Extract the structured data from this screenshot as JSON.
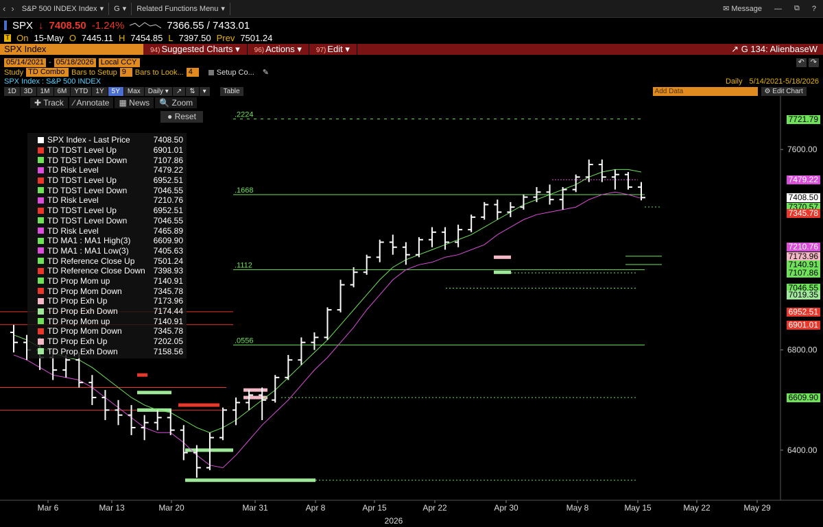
{
  "topbar": {
    "crumbs": [
      "S&P 500 INDEX Index",
      "G",
      "Related Functions Menu"
    ],
    "message": "Message",
    "icons": [
      "back-icon",
      "forward-icon",
      "chevron-down-icon",
      "envelope-icon",
      "minus-icon",
      "restore-icon",
      "help-icon"
    ]
  },
  "quote": {
    "ticker": "SPX",
    "last": "7408.50",
    "change_pct": "-1.24%",
    "range": "7366.55 / 7433.01",
    "on_label": "On",
    "date": "15-May",
    "open_label": "O",
    "open": "7445.11",
    "high_label": "H",
    "high": "7454.85",
    "low_label": "L",
    "low": "7397.50",
    "prev_label": "Prev",
    "prev": "7501.24"
  },
  "menu": {
    "ticker_field": "SPX Index",
    "items": [
      {
        "num": "94)",
        "label": "Suggested Charts"
      },
      {
        "num": "96)",
        "label": "Actions"
      },
      {
        "num": "97)",
        "label": "Edit"
      }
    ],
    "group": "G 134: AlienbaseW"
  },
  "dates": {
    "start": "05/14/2021",
    "end": "05/18/2026",
    "ccy": "Local CCY"
  },
  "study": {
    "label": "Study",
    "name": "TD Combo",
    "bars_setup_label": "Bars to Setup",
    "bars_setup": "9",
    "bars_look_label": "Bars to Look...",
    "bars_look": "4",
    "setup_co": "Setup Co..."
  },
  "subtitle": {
    "left": "SPX Index : S&P 500 INDEX",
    "period": "Daily",
    "range": "5/14/2021-5/18/2026"
  },
  "rangebar": {
    "buttons": [
      "1D",
      "3D",
      "1M",
      "6M",
      "YTD",
      "1Y",
      "5Y",
      "Max"
    ],
    "selected": "5Y",
    "freq": "Daily",
    "table": "Table",
    "add_data": "Add Data",
    "edit_chart": "Edit Chart"
  },
  "tools": {
    "track": "Track",
    "annotate": "Annotate",
    "news": "News",
    "zoom": "Zoom",
    "reset": "Reset"
  },
  "legend": [
    {
      "name": "SPX Index - Last Price",
      "value": "7408.50",
      "color": "#ffffff"
    },
    {
      "name": "TD TDST Level Up",
      "value": "6901.01",
      "color": "#e8372b"
    },
    {
      "name": "TD TDST Level Down",
      "value": "7107.86",
      "color": "#6fe25a"
    },
    {
      "name": "TD Risk Level",
      "value": "7479.22",
      "color": "#d94fd9"
    },
    {
      "name": "TD TDST Level Up",
      "value": "6952.51",
      "color": "#e8372b"
    },
    {
      "name": "TD TDST Level Down",
      "value": "7046.55",
      "color": "#6fe25a"
    },
    {
      "name": "TD Risk Level",
      "value": "7210.76",
      "color": "#d94fd9"
    },
    {
      "name": "TD TDST Level Up",
      "value": "6952.51",
      "color": "#e8372b"
    },
    {
      "name": "TD TDST Level Down",
      "value": "7046.55",
      "color": "#6fe25a"
    },
    {
      "name": "TD Risk Level",
      "value": "7465.89",
      "color": "#d94fd9"
    },
    {
      "name": "TD MA1 : MA1 High(3)",
      "value": "6609.90",
      "color": "#6fe25a"
    },
    {
      "name": "TD MA1 : MA1 Low(3)",
      "value": "7405.63",
      "color": "#d94fd9"
    },
    {
      "name": "TD Reference Close Up",
      "value": "7501.24",
      "color": "#6fe25a"
    },
    {
      "name": "TD Reference Close Down",
      "value": "7398.93",
      "color": "#e8372b"
    },
    {
      "name": "TD Prop Mom up",
      "value": "7140.91",
      "color": "#6fe25a"
    },
    {
      "name": "TD Prop Mom Down",
      "value": "7345.78",
      "color": "#e8372b"
    },
    {
      "name": "TD Prop Exh Up",
      "value": "7173.96",
      "color": "#f2b8c6"
    },
    {
      "name": "TD Prop Exh Down",
      "value": "7174.44",
      "color": "#9fe89a"
    },
    {
      "name": "TD Prop Mom up",
      "value": "7140.91",
      "color": "#6fe25a"
    },
    {
      "name": "TD Prop Mom Down",
      "value": "7345.78",
      "color": "#e8372b"
    },
    {
      "name": "TD Prop Exh Up",
      "value": "7202.05",
      "color": "#f2b8c6"
    },
    {
      "name": "TD Prop Exh Down",
      "value": "7158.56",
      "color": "#9fe89a"
    }
  ],
  "price_labels": [
    {
      "text": "7721.79",
      "value": 7721.79,
      "color": "#6fe25a"
    },
    {
      "text": "7479.22",
      "value": 7479.22,
      "color": "#d94fd9"
    },
    {
      "text": "7408.50",
      "value": 7408.5,
      "color": "#ffffff"
    },
    {
      "text": "7370.57",
      "value": 7370.57,
      "color": "#6fe25a"
    },
    {
      "text": "7345.78",
      "value": 7345.78,
      "color": "#e8372b"
    },
    {
      "text": "7210.76",
      "value": 7210.76,
      "color": "#d94fd9"
    },
    {
      "text": "7173.96",
      "value": 7173.96,
      "color": "#f2b8c6"
    },
    {
      "text": "7140.91",
      "value": 7140.91,
      "color": "#6fe25a"
    },
    {
      "text": "7107.86",
      "value": 7107.86,
      "color": "#6fe25a"
    },
    {
      "text": "7046.55",
      "value": 7046.55,
      "color": "#6fe25a"
    },
    {
      "text": "7019.35",
      "value": 7019.35,
      "color": "#9fe89a"
    },
    {
      "text": "6952.51",
      "value": 6952.51,
      "color": "#e8372b"
    },
    {
      "text": "6901.01",
      "value": 6901.01,
      "color": "#e8372b"
    },
    {
      "text": "6609.90",
      "value": 6609.9,
      "color": "#6fe25a"
    }
  ],
  "fib_labels": [
    {
      "text": ".2224",
      "value": 7721.79
    },
    {
      "text": ".1668",
      "value": 7420
    },
    {
      "text": ".1112",
      "value": 7120
    },
    {
      "text": ".0556",
      "value": 6820
    }
  ],
  "chart_data": {
    "type": "bar",
    "ylim": [
      6200,
      7800
    ],
    "yticks": [
      "7600.00",
      "6800.00",
      "6400.00"
    ],
    "ytick_values": [
      7600,
      6800,
      6400
    ],
    "xticks": [
      "Mar 6",
      "Mar 13",
      "Mar 20",
      "Mar 31",
      "Apr 8",
      "Apr 15",
      "Apr 22",
      "Apr 30",
      "May 8",
      "May 15",
      "May 22",
      "May 29"
    ],
    "year_label": "2026",
    "bars": [
      [
        6870,
        6900,
        6790,
        6830
      ],
      [
        6830,
        6860,
        6760,
        6800
      ],
      [
        6800,
        6850,
        6720,
        6770
      ],
      [
        6770,
        6800,
        6680,
        6720
      ],
      [
        6720,
        6780,
        6690,
        6760
      ],
      [
        6760,
        6790,
        6650,
        6670
      ],
      [
        6670,
        6700,
        6580,
        6610
      ],
      [
        6610,
        6640,
        6520,
        6560
      ],
      [
        6560,
        6600,
        6500,
        6540
      ],
      [
        6540,
        6580,
        6460,
        6490
      ],
      [
        6490,
        6540,
        6440,
        6510
      ],
      [
        6510,
        6560,
        6480,
        6530
      ],
      [
        6530,
        6560,
        6460,
        6480
      ],
      [
        6480,
        6500,
        6360,
        6390
      ],
      [
        6390,
        6420,
        6290,
        6330
      ],
      [
        6330,
        6470,
        6320,
        6450
      ],
      [
        6450,
        6570,
        6440,
        6560
      ],
      [
        6560,
        6610,
        6500,
        6590
      ],
      [
        6590,
        6640,
        6560,
        6620
      ],
      [
        6620,
        6650,
        6520,
        6600
      ],
      [
        6600,
        6700,
        6590,
        6690
      ],
      [
        6690,
        6780,
        6680,
        6760
      ],
      [
        6760,
        6850,
        6740,
        6830
      ],
      [
        6830,
        6870,
        6800,
        6850
      ],
      [
        6850,
        6970,
        6840,
        6960
      ],
      [
        6960,
        7080,
        6950,
        7060
      ],
      [
        7060,
        7130,
        7050,
        7110
      ],
      [
        7110,
        7180,
        7100,
        7170
      ],
      [
        7170,
        7240,
        7150,
        7230
      ],
      [
        7230,
        7260,
        7180,
        7210
      ],
      [
        7210,
        7230,
        7140,
        7180
      ],
      [
        7180,
        7250,
        7170,
        7240
      ],
      [
        7240,
        7290,
        7210,
        7270
      ],
      [
        7270,
        7290,
        7200,
        7230
      ],
      [
        7230,
        7300,
        7210,
        7280
      ],
      [
        7280,
        7340,
        7270,
        7330
      ],
      [
        7330,
        7390,
        7320,
        7380
      ],
      [
        7380,
        7400,
        7320,
        7350
      ],
      [
        7350,
        7390,
        7330,
        7370
      ],
      [
        7370,
        7420,
        7360,
        7410
      ],
      [
        7410,
        7450,
        7390,
        7430
      ],
      [
        7430,
        7460,
        7380,
        7400
      ],
      [
        7400,
        7450,
        7360,
        7440
      ],
      [
        7440,
        7500,
        7430,
        7490
      ],
      [
        7490,
        7560,
        7470,
        7540
      ],
      [
        7540,
        7560,
        7470,
        7490
      ],
      [
        7490,
        7520,
        7440,
        7500
      ],
      [
        7500,
        7510,
        7440,
        7450
      ],
      [
        7450,
        7470,
        7397,
        7408
      ]
    ],
    "ma_high": [
      6860,
      6840,
      6810,
      6790,
      6770,
      6760,
      6730,
      6690,
      6650,
      6610,
      6580,
      6560,
      6550,
      6520,
      6490,
      6470,
      6490,
      6520,
      6560,
      6600,
      6640,
      6690,
      6740,
      6790,
      6840,
      6900,
      6960,
      7020,
      7080,
      7130,
      7160,
      7180,
      7200,
      7220,
      7240,
      7260,
      7290,
      7320,
      7350,
      7380,
      7400,
      7420,
      7440,
      7460,
      7490,
      7510,
      7520,
      7520,
      7510
    ],
    "ma_low": [
      6780,
      6760,
      6730,
      6700,
      6690,
      6680,
      6650,
      6610,
      6570,
      6530,
      6490,
      6470,
      6470,
      6430,
      6380,
      6340,
      6330,
      6380,
      6440,
      6500,
      6550,
      6600,
      6660,
      6720,
      6770,
      6830,
      6890,
      6960,
      7020,
      7080,
      7120,
      7140,
      7150,
      7170,
      7180,
      7200,
      7220,
      7260,
      7290,
      7320,
      7340,
      7350,
      7360,
      7370,
      7400,
      7420,
      7430,
      7420,
      7405
    ]
  }
}
